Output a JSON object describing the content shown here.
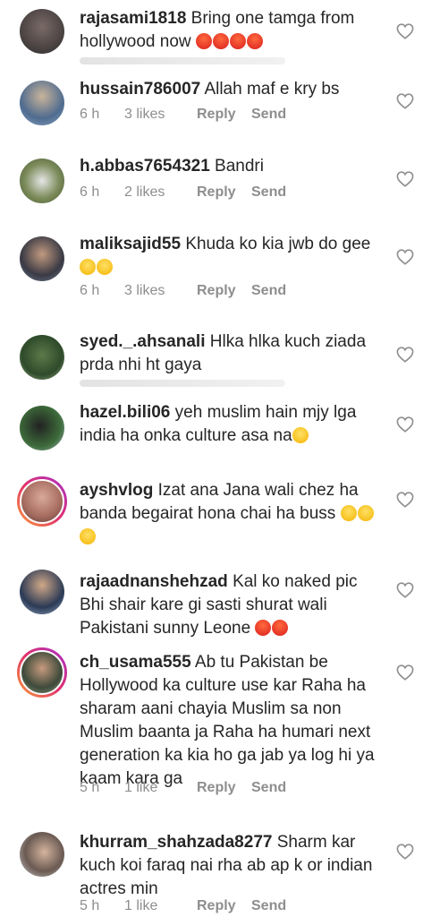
{
  "comments": [
    {
      "user": "rajasami1818",
      "text": "Bring one tamga from hollywood now"
    },
    {
      "user": "hussain786007",
      "text": "Allah maf e kry bs",
      "time": "6 h",
      "likes": "3 likes",
      "reply": "Reply",
      "send": "Send"
    },
    {
      "user": "h.abbas7654321",
      "text": "Bandri",
      "time": "6 h",
      "likes": "2 likes",
      "reply": "Reply",
      "send": "Send"
    },
    {
      "user": "maliksajid55",
      "text": "Khuda ko kia jwb do gee",
      "time": "6 h",
      "likes": "3 likes",
      "reply": "Reply",
      "send": "Send"
    },
    {
      "user": "syed._.ahsanali",
      "text": "Hlka hlka kuch ziada prda nhi ht gaya"
    },
    {
      "user": "hazel.bili06",
      "text": "yeh muslim hain mjy lga india ha onka culture asa na"
    },
    {
      "user": "ayshvlog",
      "text": "Izat ana Jana wali chez ha banda begairat hona chai ha buss"
    },
    {
      "user": "rajaadnanshehzad",
      "text": "Kal ko naked pic Bhi shair kare gi sasti shurat wali Pakistani sunny Leone"
    },
    {
      "user": "ch_usama555",
      "text": "Ab tu Pakistan be Hollywood ka culture use kar Raha ha sharam aani chayia Muslim sa non Muslim baanta ja Raha ha humari next generation ka kia ho ga jab ya log hi ya kaam kara ga",
      "time": "5 h",
      "likes": "1 like",
      "reply": "Reply",
      "send": "Send"
    },
    {
      "user": "khurram_shahzada8277",
      "text": "Sharm kar kuch koi faraq nai rha ab ap k or indian actres min",
      "time": "5 h",
      "likes": "1 like",
      "reply": "Reply",
      "send": "Send"
    }
  ],
  "colors": {
    "text": "#262626",
    "meta": "#8e8e8e",
    "heart": "#8e8e8e"
  }
}
